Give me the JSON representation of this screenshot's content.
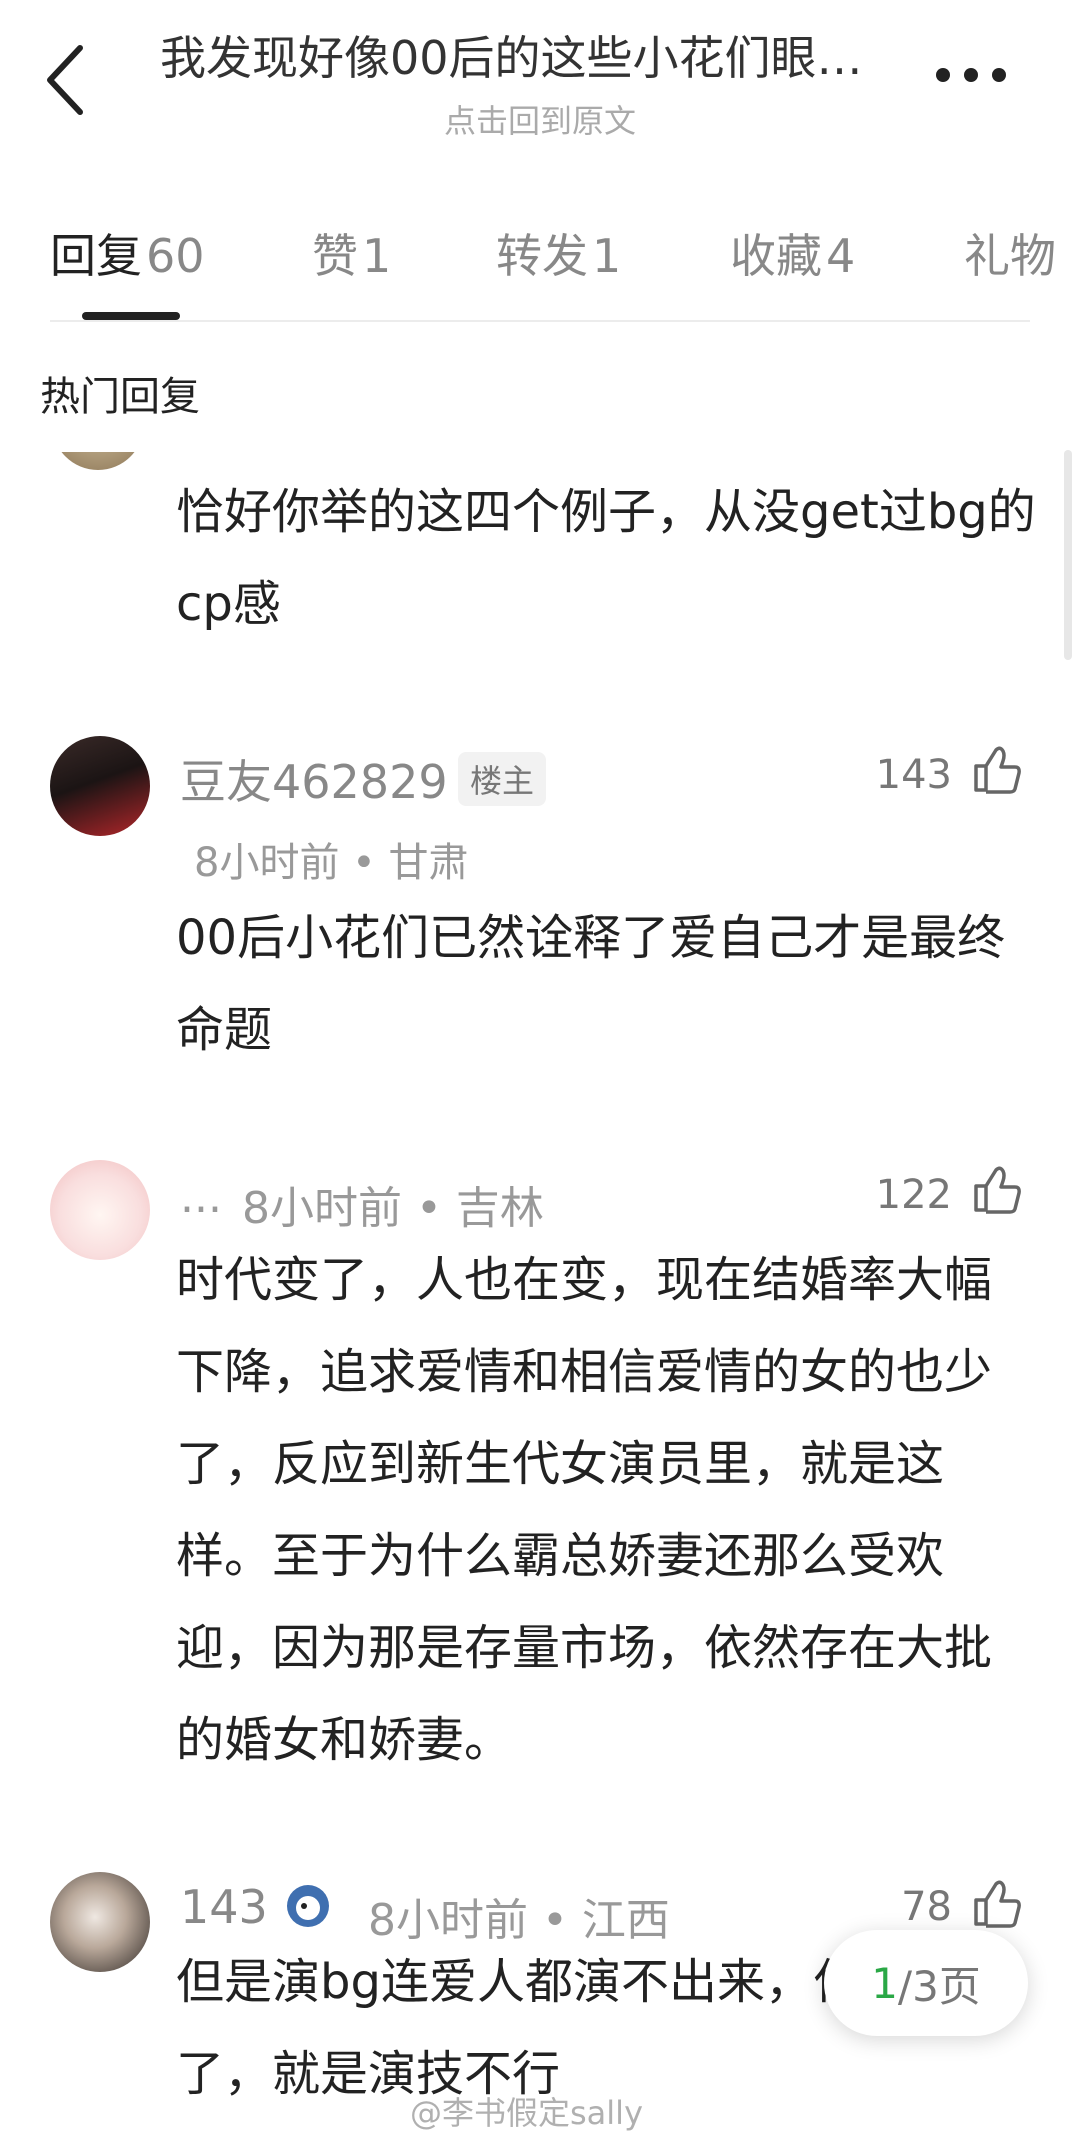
{
  "header": {
    "title": "我发现好像00后的这些小花们眼…",
    "subtitle": "点击回到原文"
  },
  "tabs": [
    {
      "label": "回复",
      "count": "60"
    },
    {
      "label": "赞",
      "count": "1"
    },
    {
      "label": "转发",
      "count": "1"
    },
    {
      "label": "收藏",
      "count": "4"
    },
    {
      "label": "礼物",
      "count": ""
    }
  ],
  "section_heading": "热门回复",
  "comments": [
    {
      "text": "恰好你举的这四个例子，从没get过bg的cp感"
    },
    {
      "username": "豆友462829",
      "badge": "楼主",
      "meta": "8小时前 • 甘肃",
      "likes": "143",
      "text": "00后小花们已然诠释了爱自己才是最终命题"
    },
    {
      "username": "...",
      "meta": "8小时前 • 吉林",
      "likes": "122",
      "text": "时代变了，人也在变，现在结婚率大幅下降，追求爱情和相信爱情的女的也少了，反应到新生代女演员里，就是这样。至于为什么霸总娇妻还那么受欢迎，因为那是存量市场，依然存在大批的婚女和娇妻。"
    },
    {
      "username": "143",
      "meta": "8小时前 • 江西",
      "likes": "78",
      "text": "但是演bg连爱人都演不出来，什么时代了，就是演技不行"
    }
  ],
  "pager": {
    "current": "1",
    "total": "/3页"
  },
  "watermark": "@李书假定sally",
  "colors": {
    "accent_green": "#2aa846",
    "text_primary": "#222222",
    "text_secondary": "#888888"
  }
}
